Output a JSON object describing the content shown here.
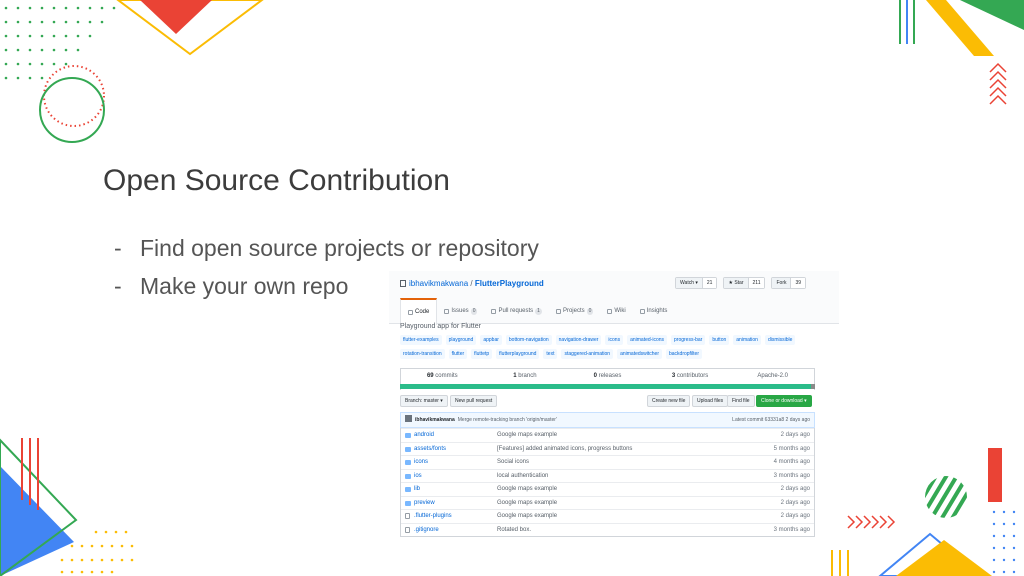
{
  "slide": {
    "title": "Open Source Contribution",
    "bullets": [
      {
        "dash": "-",
        "text": "Find open source projects or repository"
      },
      {
        "dash": "-",
        "text": "Make your own repo"
      }
    ]
  },
  "github": {
    "owner": "ibhavikmakwana",
    "separator": "/",
    "repo": "FlutterPlayground",
    "actions": [
      {
        "label": "Watch ▾",
        "count": "21"
      },
      {
        "label": "★ Star",
        "count": "211"
      },
      {
        "label": "Fork",
        "count": "39"
      }
    ],
    "tabs": [
      {
        "label": "Code",
        "count": ""
      },
      {
        "label": "Issues",
        "count": "0"
      },
      {
        "label": "Pull requests",
        "count": "1"
      },
      {
        "label": "Projects",
        "count": "0"
      },
      {
        "label": "Wiki",
        "count": ""
      },
      {
        "label": "Insights",
        "count": ""
      }
    ],
    "description": "Playground app for Flutter",
    "topics": [
      "flutter-examples",
      "playground",
      "appbar",
      "bottom-navigation",
      "navigation-drawer",
      "icons",
      "animated-icons",
      "progress-bar",
      "button",
      "animation",
      "dismissible",
      "rotation-transition",
      "flutter",
      "fluttetp",
      "flutterplayground",
      "text",
      "staggered-animation",
      "animatedswitcher",
      "backdropfilter"
    ],
    "summary": [
      {
        "count": "69",
        "label": "commits"
      },
      {
        "count": "1",
        "label": "branch"
      },
      {
        "count": "0",
        "label": "releases"
      },
      {
        "count": "3",
        "label": "contributors"
      },
      {
        "count": "",
        "label": "Apache-2.0"
      }
    ],
    "toolbar": {
      "branch": "Branch: master ▾",
      "new_pr": "New pull request",
      "create_file": "Create new file",
      "upload_files": "Upload files",
      "find_file": "Find file",
      "clone": "Clone or download ▾"
    },
    "commit": {
      "user": "ibhavikmakwana",
      "message": "Merge remote-tracking branch 'origin/master'",
      "latest": "Latest commit 63331a8 2 days ago"
    },
    "files": [
      {
        "name": "android",
        "type": "dir",
        "message": "Google maps example",
        "age": "2 days ago"
      },
      {
        "name": "assets/fonts",
        "type": "dir",
        "message": "[Features] added animated icons, progress buttons",
        "age": "5 months ago"
      },
      {
        "name": "icons",
        "type": "dir",
        "message": "Social icons",
        "age": "4 months ago"
      },
      {
        "name": "ios",
        "type": "dir",
        "message": "local authentication",
        "age": "3 months ago"
      },
      {
        "name": "lib",
        "type": "dir",
        "message": "Google maps example",
        "age": "2 days ago"
      },
      {
        "name": "preview",
        "type": "dir",
        "message": "Google maps example",
        "age": "2 days ago"
      },
      {
        "name": ".flutter-plugins",
        "type": "file",
        "message": "Google maps example",
        "age": "2 days ago"
      },
      {
        "name": ".gitignore",
        "type": "file",
        "message": "Rotated box.",
        "age": "3 months ago"
      }
    ]
  },
  "colors": {
    "google_red": "#ea4335",
    "google_green": "#34a853",
    "google_yellow": "#fbbc04",
    "google_blue": "#4285f4",
    "lang_teal": "#2bbc8a"
  }
}
